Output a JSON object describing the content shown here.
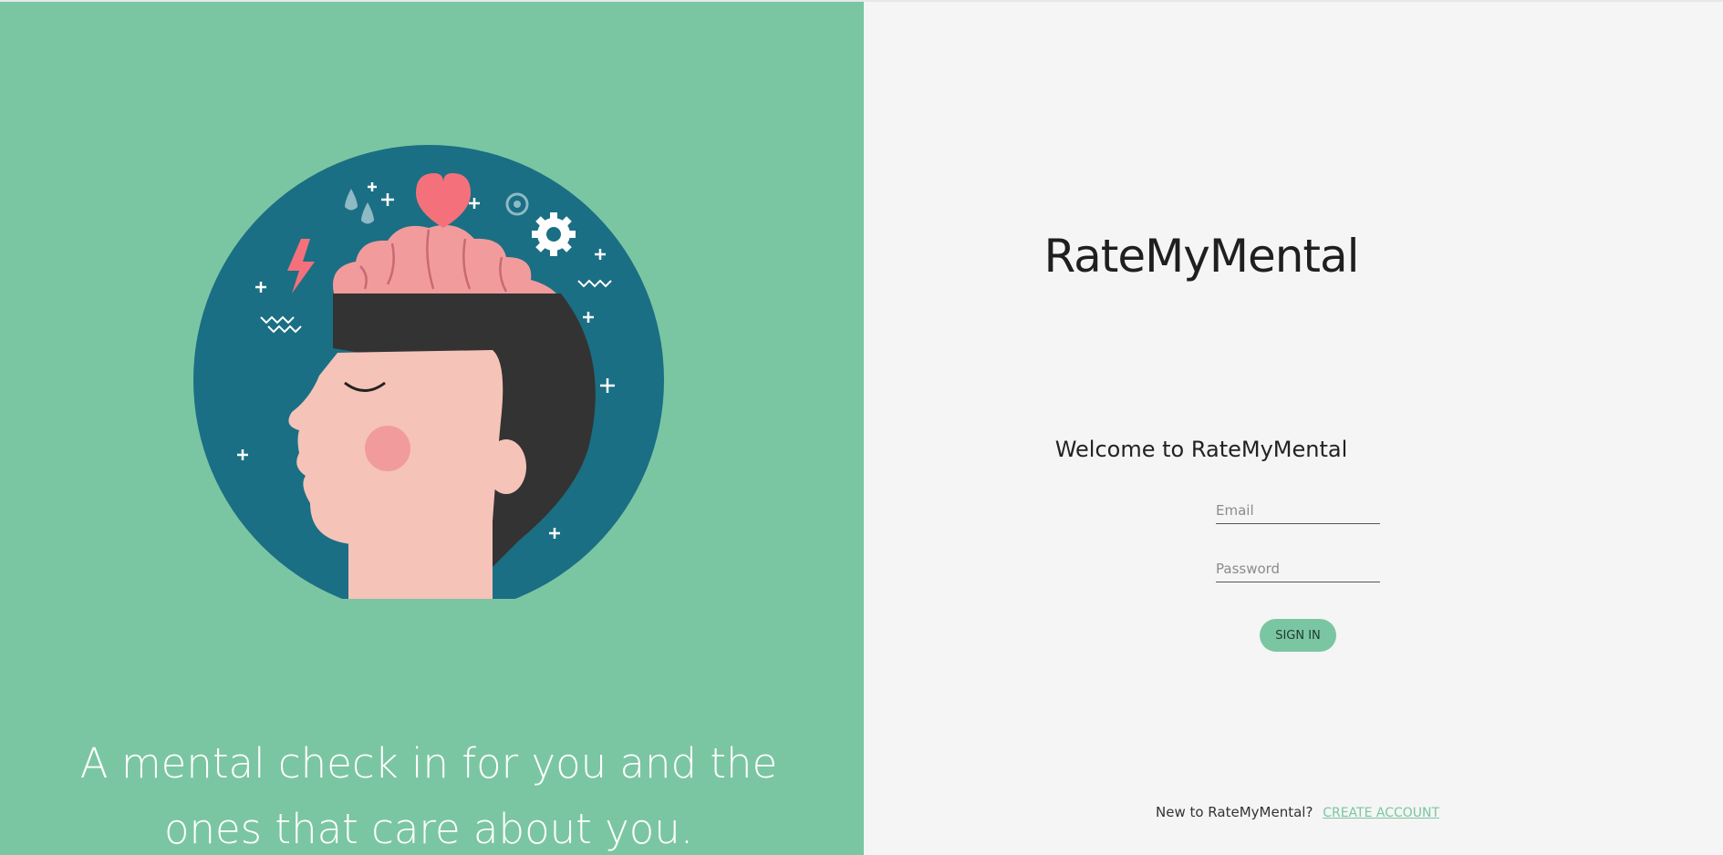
{
  "brand": {
    "name": "RateMyMental",
    "accent": "#7bc6a2",
    "panel_color": "#7bc6a2"
  },
  "left": {
    "tagline_line1": "A mental check in for you and the",
    "tagline_line2": "ones that care about you.",
    "illustration": {
      "name": "head-with-brain-illustration"
    }
  },
  "login": {
    "welcome": "Welcome to RateMyMental",
    "email_placeholder": "Email",
    "password_placeholder": "Password",
    "signin_label": "SIGN IN",
    "footer_text": "New to RateMyMental?",
    "create_account_label": "CREATE ACCOUNT"
  }
}
